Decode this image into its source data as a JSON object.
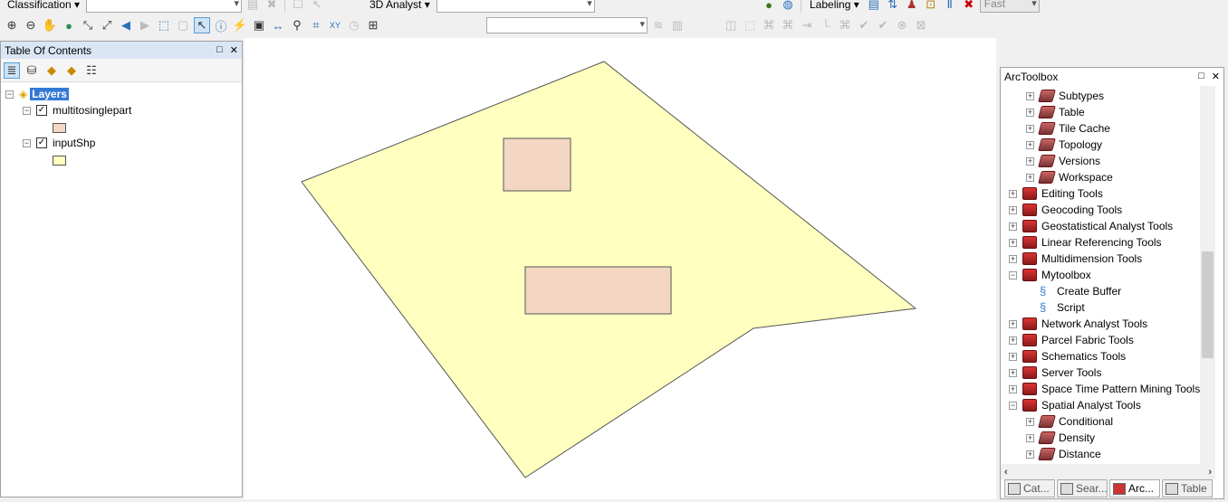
{
  "toolbar": {
    "classification_label": "Classification",
    "analyst_label": "3D Analyst",
    "labeling_label": "Labeling",
    "quality_value": "Fast"
  },
  "toc": {
    "title": "Table Of Contents",
    "root": "Layers",
    "layers": [
      {
        "name": "multitosinglepart",
        "checked": true,
        "color": "#f4d7c3"
      },
      {
        "name": "inputShp",
        "checked": true,
        "color": "#ffffc0"
      }
    ]
  },
  "map": {
    "polygon_fill": "#ffffc0",
    "rect_fill": "#f4d7c3"
  },
  "arctoolbox": {
    "title": "ArcToolbox",
    "items": [
      {
        "label": "Subtypes",
        "level": 1,
        "type": "toolset",
        "state": "+"
      },
      {
        "label": "Table",
        "level": 1,
        "type": "toolset",
        "state": "+"
      },
      {
        "label": "Tile Cache",
        "level": 1,
        "type": "toolset",
        "state": "+"
      },
      {
        "label": "Topology",
        "level": 1,
        "type": "toolset",
        "state": "+"
      },
      {
        "label": "Versions",
        "level": 1,
        "type": "toolset",
        "state": "+"
      },
      {
        "label": "Workspace",
        "level": 1,
        "type": "toolset",
        "state": "+"
      },
      {
        "label": "Editing Tools",
        "level": 0,
        "type": "toolbox",
        "state": "+"
      },
      {
        "label": "Geocoding Tools",
        "level": 0,
        "type": "toolbox",
        "state": "+"
      },
      {
        "label": "Geostatistical Analyst Tools",
        "level": 0,
        "type": "toolbox",
        "state": "+"
      },
      {
        "label": "Linear Referencing Tools",
        "level": 0,
        "type": "toolbox",
        "state": "+"
      },
      {
        "label": "Multidimension Tools",
        "level": 0,
        "type": "toolbox",
        "state": "+"
      },
      {
        "label": "Mytoolbox",
        "level": 0,
        "type": "toolbox",
        "state": "-"
      },
      {
        "label": "Create Buffer",
        "level": 1,
        "type": "script",
        "state": ""
      },
      {
        "label": "Script",
        "level": 1,
        "type": "script",
        "state": ""
      },
      {
        "label": "Network Analyst Tools",
        "level": 0,
        "type": "toolbox",
        "state": "+"
      },
      {
        "label": "Parcel Fabric Tools",
        "level": 0,
        "type": "toolbox",
        "state": "+"
      },
      {
        "label": "Schematics Tools",
        "level": 0,
        "type": "toolbox",
        "state": "+"
      },
      {
        "label": "Server Tools",
        "level": 0,
        "type": "toolbox",
        "state": "+"
      },
      {
        "label": "Space Time Pattern Mining Tools",
        "level": 0,
        "type": "toolbox",
        "state": "+"
      },
      {
        "label": "Spatial Analyst Tools",
        "level": 0,
        "type": "toolbox",
        "state": "-"
      },
      {
        "label": "Conditional",
        "level": 1,
        "type": "toolset",
        "state": "+"
      },
      {
        "label": "Density",
        "level": 1,
        "type": "toolset",
        "state": "+"
      },
      {
        "label": "Distance",
        "level": 1,
        "type": "toolset",
        "state": "+"
      }
    ],
    "tabs": [
      "Cat...",
      "Sear...",
      "Arc...",
      "Table"
    ]
  }
}
